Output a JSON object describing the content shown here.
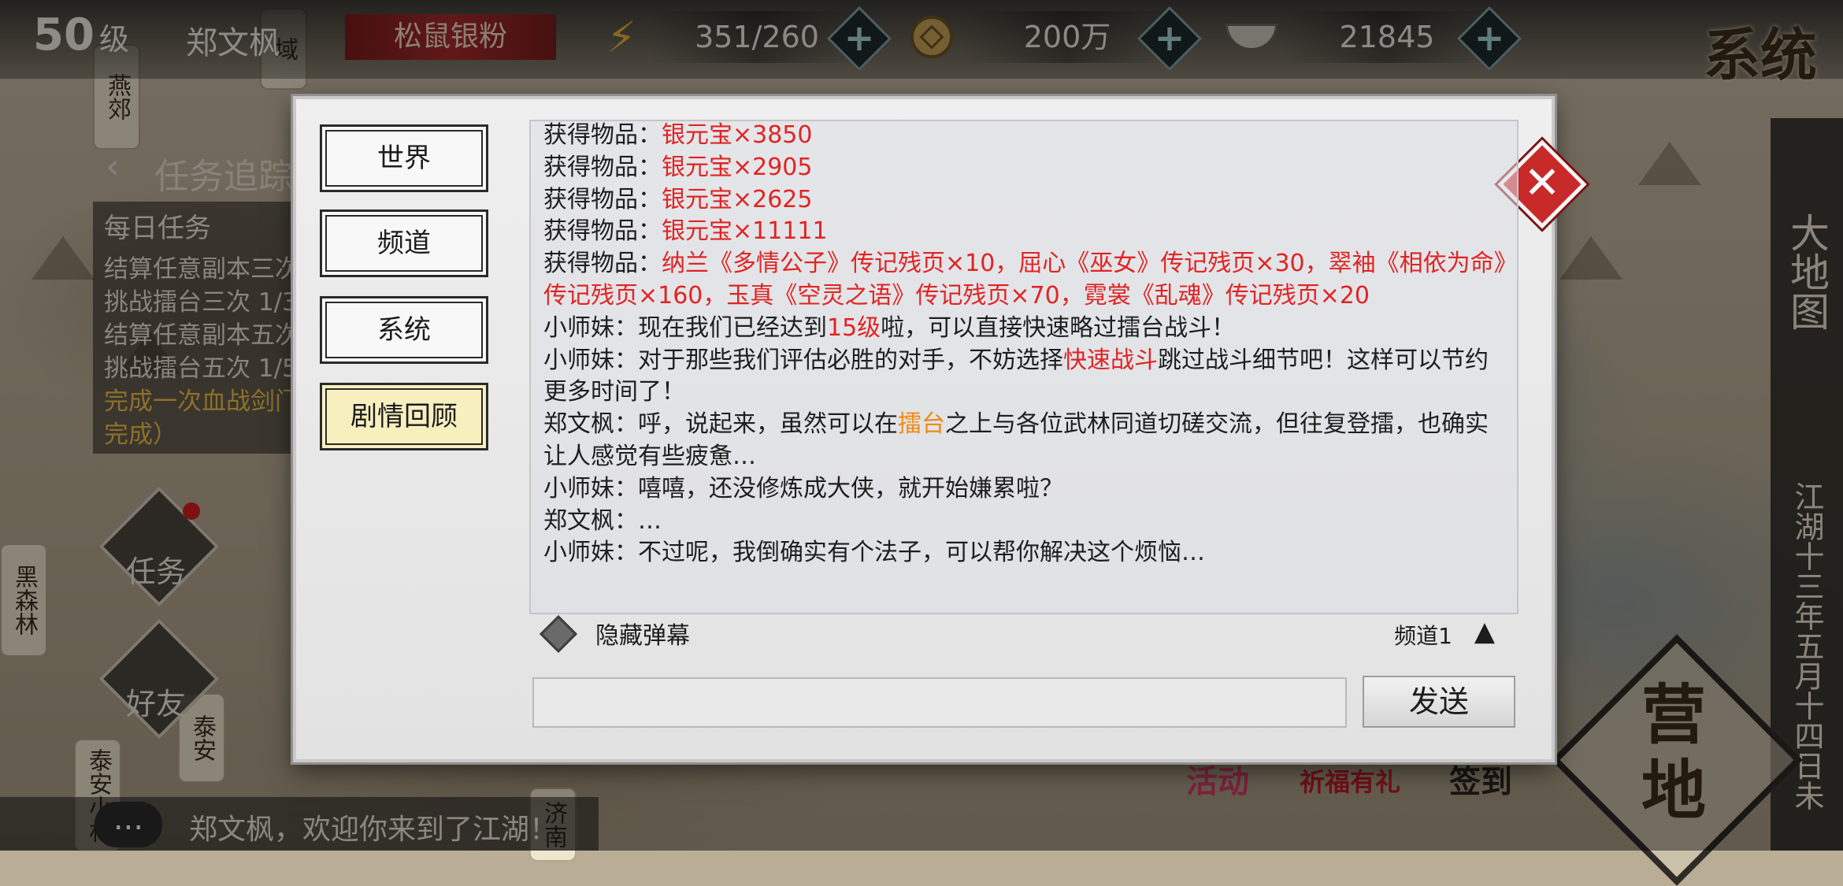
{
  "topbar": {
    "level": "50",
    "level_unit": "级",
    "player_name": "郑文枫",
    "title_badge": "松鼠银粉",
    "stamina": "351/260",
    "coins": "200万",
    "silver": "21845"
  },
  "right_menu": {
    "system": "系统",
    "world_map": "大地图",
    "date": "江湖十三年五月十四日未",
    "camp": "营地"
  },
  "tasks": {
    "header": "任务追踪",
    "section": "每日任务",
    "items": [
      "结算任意副本三次",
      "挑战擂台三次 1/3",
      "结算任意副本五次",
      "挑战擂台五次 1/5",
      "完成一次血战剑门",
      "完成）"
    ]
  },
  "side_buttons": {
    "task": "任务",
    "friends": "好友"
  },
  "map_labels": [
    "燕郊",
    "域",
    "黑森林",
    "泰安",
    "泰安小村",
    "济南"
  ],
  "activities": {
    "event": "活动",
    "blessing": "祈福有礼",
    "signin": "签到"
  },
  "chat_bar": {
    "icon": "...",
    "message": "郑文枫，欢迎你来到了江湖！"
  },
  "dialog": {
    "tabs": [
      "世界",
      "频道",
      "系统",
      "剧情回顾"
    ],
    "active_tab": "剧情回顾",
    "log": [
      {
        "prefix": "获得物品：",
        "item": "银元宝×3850"
      },
      {
        "prefix": "获得物品：",
        "item": "银元宝×2905"
      },
      {
        "prefix": "获得物品：",
        "item": "银元宝×2625"
      },
      {
        "prefix": "获得物品：",
        "item": "银元宝×11111"
      },
      {
        "prefix": "获得物品：",
        "item": "纳兰《多情公子》传记残页×10，屈心《巫女》传记残页×30，翠袖《相依为命》传记残页×160，玉真《空灵之语》传记残页×70，霓裳《乱魂》传记残页×20"
      },
      {
        "speaker": "小师妹：",
        "before": "现在我们已经达到",
        "hl": "15级",
        "after": "啦，可以直接快速略过擂台战斗！"
      },
      {
        "speaker": "小师妹：",
        "before": "对于那些我们评估必胜的对手，不妨选择",
        "hl": "快速战斗",
        "after": "跳过战斗细节吧！这样可以节约更多时间了！"
      },
      {
        "speaker": "郑文枫：",
        "before": "呼，说起来，虽然可以在",
        "hl": "擂台",
        "after": "之上与各位武林同道切磋交流，但往复登擂，也确实让人感觉有些疲惫…"
      },
      {
        "speaker": "小师妹：",
        "text": "嘻嘻，还没修炼成大侠，就开始嫌累啦？"
      },
      {
        "speaker": "郑文枫：",
        "text": "…"
      },
      {
        "speaker": "小师妹：",
        "text": "不过呢，我倒确实有个法子，可以帮你解决这个烦恼…"
      }
    ],
    "hide_barrage": "隐藏弹幕",
    "channel": "频道1",
    "input_placeholder": "",
    "send": "发送"
  },
  "colors": {
    "highlight_red": "#e02424",
    "highlight_orange": "#f08a12",
    "active_tab": "#f8efbf",
    "close_button": "#c82a2a"
  },
  "icons": {
    "stamina": "lightning-icon",
    "coins": "coin-icon",
    "silver": "ingot-icon",
    "close": "close-icon",
    "chat": "chat-bubble-icon"
  }
}
